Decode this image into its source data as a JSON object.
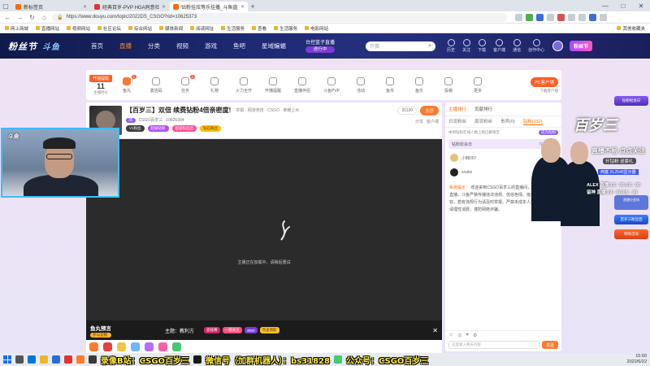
{
  "browser": {
    "tabs": [
      {
        "label": "新标签页",
        "active": false
      },
      {
        "label": "经典百岁-PVP HGA同意社区",
        "active": false
      },
      {
        "label": "钻粉挂炫等乐挂播_斗鱼直播平台",
        "active": true
      }
    ],
    "url": "https://www.douyu.com/topic/2022DS_CSGO?rid=10625373",
    "bookmarks": [
      "网上商城",
      "直播网站",
      "视频网站",
      "社区论坛",
      "综合网站",
      "媒体新闻",
      "阅读网址",
      "生活服务",
      "查看",
      "生活服务",
      "电影网站"
    ],
    "bookmark_right": "其他收藏夹"
  },
  "site": {
    "logo": "粉丝节",
    "logo_sub": "斗鱼",
    "nav": [
      "首页",
      "直播",
      "分类",
      "视频",
      "游戏",
      "鱼吧",
      "星域蝙蝠"
    ],
    "nav_active": "直播",
    "promo_top": "台控蓝子直播",
    "promo_btn": "进行中",
    "search_placeholder": "开赛",
    "icons": [
      "历史",
      "关注",
      "下载",
      "客户端",
      "通信",
      "创作中心"
    ],
    "badge": "粉丝节"
  },
  "toolbar": {
    "date_top": "开播提醒",
    "date_num": "11",
    "date_sub": "主播时长",
    "tools": [
      {
        "label": "鱼丸",
        "badge": "1"
      },
      {
        "label": "激活码",
        "badge": ""
      },
      {
        "label": "任务",
        "badge": "2"
      },
      {
        "label": "礼物",
        "badge": ""
      },
      {
        "label": "火力全开",
        "badge": ""
      },
      {
        "label": "开播提醒",
        "badge": ""
      },
      {
        "label": "直播伴侣",
        "badge": ""
      },
      {
        "label": "斗鱼PVP",
        "badge": ""
      },
      {
        "label": "活动",
        "badge": ""
      },
      {
        "label": "鱼币",
        "badge": ""
      },
      {
        "label": "鱼乐",
        "badge": ""
      },
      {
        "label": "投稿",
        "badge": ""
      },
      {
        "label": "更多",
        "badge": ""
      }
    ],
    "pc_button": "PC客户端",
    "pc_sub": "下载客户端"
  },
  "room": {
    "title": "【百岁三】双倍 续费钻粉4倍亲密度!",
    "category": "举报 · 网游竞技 · CSGO · 荣耀上水",
    "level": "35",
    "streamer": "CSGO百岁三",
    "room_id": "10625394",
    "tags": [
      "V1粉丝",
      "超级钻粉",
      "超级粉丝团",
      "钻石粉丝"
    ],
    "count": "31130",
    "follow": "关注",
    "share": "分享",
    "client": "客户端"
  },
  "video": {
    "status": "主播正在加载中，请稍后重试",
    "yugao_title": "鱼丸预言",
    "yugao_sub": "参与竞猜",
    "topic": "主题：教利方",
    "bar_items": [
      "竞技赛",
      "一键关注",
      "4900"
    ],
    "bar_right": "点击领取"
  },
  "webcam": {
    "logo": "斗鱼"
  },
  "chat": {
    "tabs1": [
      "主播排行",
      "贡献排行"
    ],
    "tabs2": [
      "日流粉丝",
      "周流粉丝",
      "贵宾(0)",
      "钻粉(232)"
    ],
    "notice": "本周钻粉在线人数上限已解锁至",
    "notice_btn": "成为钻粉",
    "fan_bar": "钻粉松会日",
    "fan_bar_more": "今日直播",
    "ranks": [
      {
        "name": "小韩007"
      },
      {
        "name": "snake"
      }
    ],
    "sys_label": "系统提示：",
    "sys_msg": "欢迎来到CSGO百岁三的直播间，倡导绿色健康直播，斗鱼严禁传播违法违规、低俗色情、吸烟酗酒等内容，若有违规行为请及时举报。严禁未成年人直播或打赏。请理性消费，谨防网络诈骗。",
    "input_placeholder": "这里输入聊天内容",
    "send": "发送"
  },
  "ad": {
    "big": "百岁三",
    "headline": "直播不易 点点关注",
    "sub1": "开钻粉 送豪礼",
    "sub2": "西塞 XL2540显示器",
    "schedule": [
      "ALEX 直播  13：00-19：00",
      "留神 直播  19：00-01：00"
    ]
  },
  "rightbar": {
    "items": [
      "钻粉松会日",
      "百岁三粉丝团",
      "特殊活动"
    ],
    "minis": [
      "直播分会场",
      "活动3个月",
      "钻粉专享"
    ]
  },
  "taskbar": {
    "overlay1": "录像B站：CSGO百岁三",
    "overlay2": "微信号（加群机器人）：bs31828",
    "overlay3": "公众号：CSGO百岁三",
    "time": "15:00",
    "date": "2022/6/22"
  }
}
